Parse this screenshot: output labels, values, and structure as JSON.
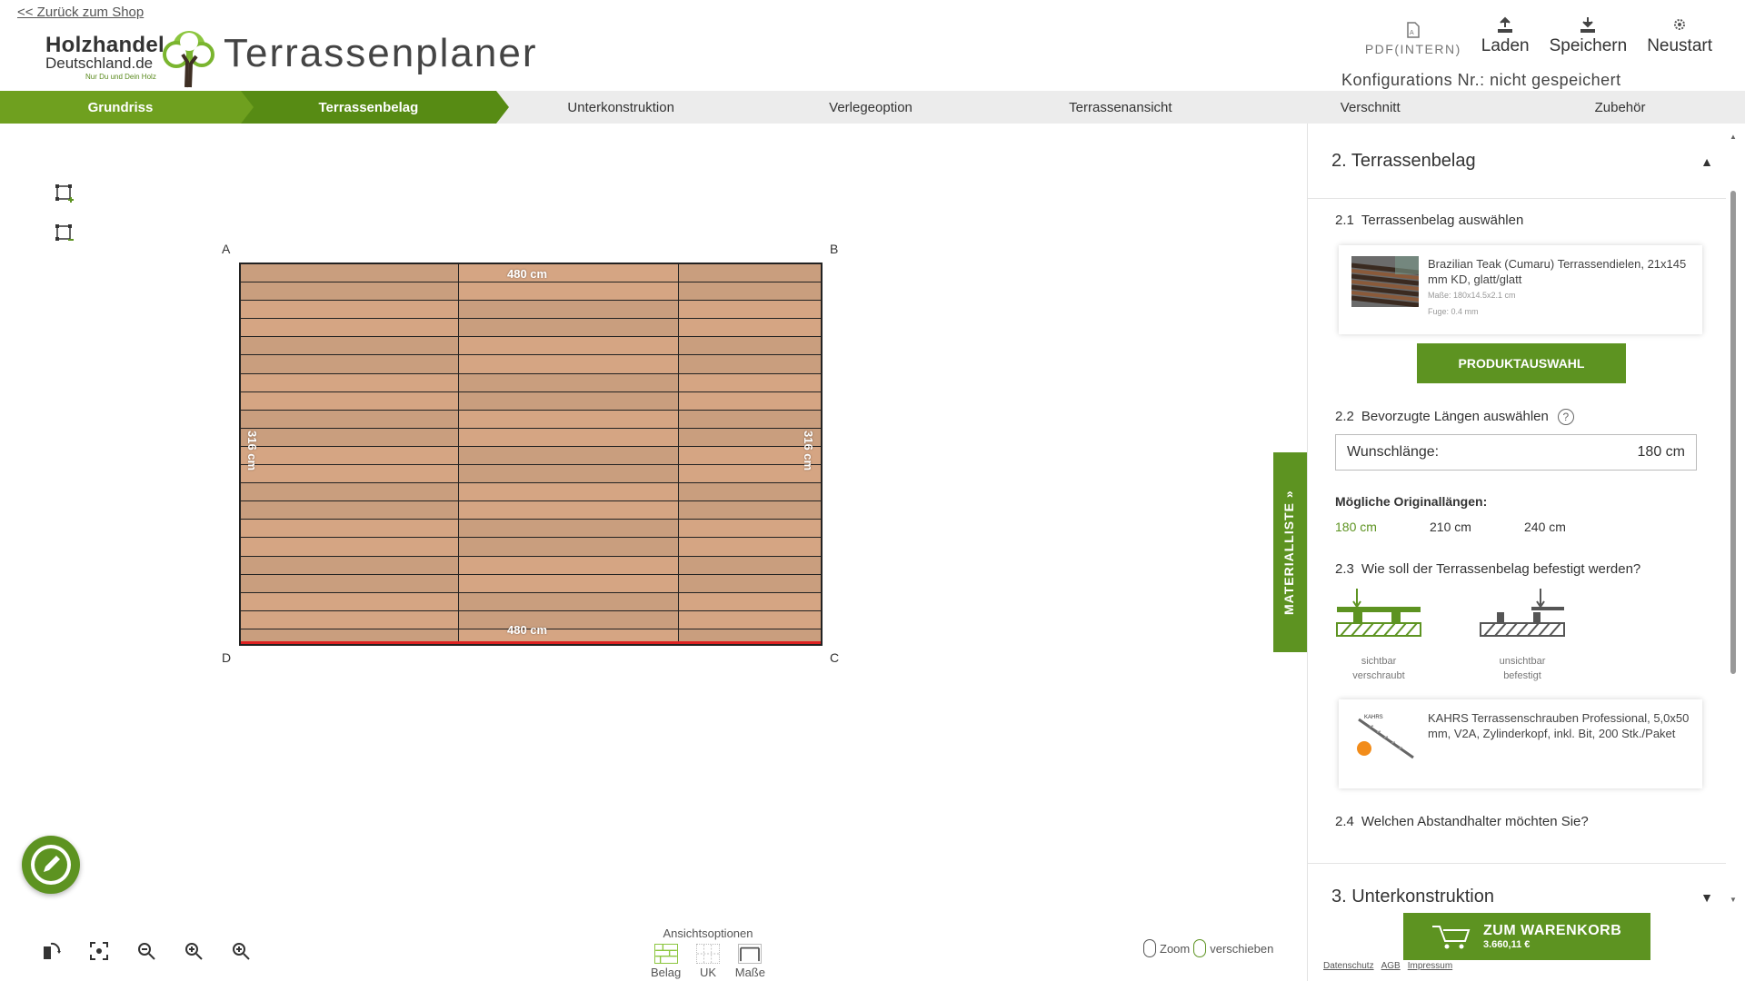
{
  "header": {
    "back_link": "<< Zurück zum Shop",
    "logo_line1": "Holzhandel",
    "logo_line2": "Deutschland.de",
    "logo_tagline": "Nur Du und Dein Holz",
    "title": "Terrassenplaner",
    "actions": {
      "pdf": "PDF(INTERN)",
      "load": "Laden",
      "save": "Speichern",
      "restart": "Neustart"
    },
    "config_nr": "Konfigurations Nr.: nicht gespeichert"
  },
  "steps": [
    {
      "label": "Grundriss",
      "state": "done"
    },
    {
      "label": "Terrassenbelag",
      "state": "active"
    },
    {
      "label": "Unterkonstruktion",
      "state": "todo"
    },
    {
      "label": "Verlegeoption",
      "state": "todo"
    },
    {
      "label": "Terrassenansicht",
      "state": "todo"
    },
    {
      "label": "Verschnitt",
      "state": "todo"
    },
    {
      "label": "Zubehör",
      "state": "todo"
    }
  ],
  "canvas": {
    "corners": {
      "a": "A",
      "b": "B",
      "c": "C",
      "d": "D"
    },
    "width_label_top": "480 cm",
    "width_label_bottom": "480 cm",
    "height_label_left": "316 cm",
    "height_label_right": "316 cm",
    "plank_rows": 21,
    "plank_colors": [
      "#c99e7e",
      "#e8b48c",
      "#d5a583",
      "#e4ad87"
    ],
    "edge_color": "#dd2222"
  },
  "view_options": {
    "title": "Ansichtsoptionen",
    "items": [
      "Belag",
      "UK",
      "Maße"
    ]
  },
  "mouse_hint": {
    "zoom": "Zoom",
    "move": "verschieben"
  },
  "materialliste": "MATERIALLISTE »",
  "panel": {
    "section2_title": "2. Terrassenbelag",
    "s21": {
      "num": "2.1",
      "label": "Terrassenbelag auswählen"
    },
    "product": {
      "name": "Brazilian Teak (Cumaru) Terrassendielen, 21x145 mm KD, glatt/glatt",
      "dims": "Maße: 180x14.5x2.1 cm",
      "gap": "Fuge: 0.4 mm"
    },
    "product_button": "PRODUKTAUSWAHL",
    "s22": {
      "num": "2.2",
      "label": "Bevorzugte Längen auswählen"
    },
    "wunsch_label": "Wunschlänge:",
    "wunsch_value": "180 cm",
    "orig_title": "Mögliche Originallängen:",
    "lengths": [
      "180 cm",
      "210 cm",
      "240 cm"
    ],
    "s23": {
      "num": "2.3",
      "label": "Wie soll der Terrassenbelag befestigt werden?"
    },
    "fix_visible": {
      "l1": "sichtbar",
      "l2": "verschraubt"
    },
    "fix_hidden": {
      "l1": "unsichtbar",
      "l2": "befestigt"
    },
    "screw": {
      "name": "KAHRS Terrassenschrauben Professional, 5,0x50 mm, V2A, Zylinderkopf, inkl. Bit, 200 Stk./Paket",
      "brand": "KAHRS"
    },
    "s24": {
      "num": "2.4",
      "label": "Welchen Abstandhalter möchten Sie?"
    },
    "section3_title": "3. Unterkonstruktion"
  },
  "cart": {
    "label": "ZUM WARENKORB",
    "price": "3.660,11 €"
  },
  "footer": {
    "privacy": "Datenschutz",
    "agb": "AGB",
    "imprint": "Impressum"
  },
  "colors": {
    "accent": "#5d9321",
    "accent_light": "#6fa01f"
  }
}
